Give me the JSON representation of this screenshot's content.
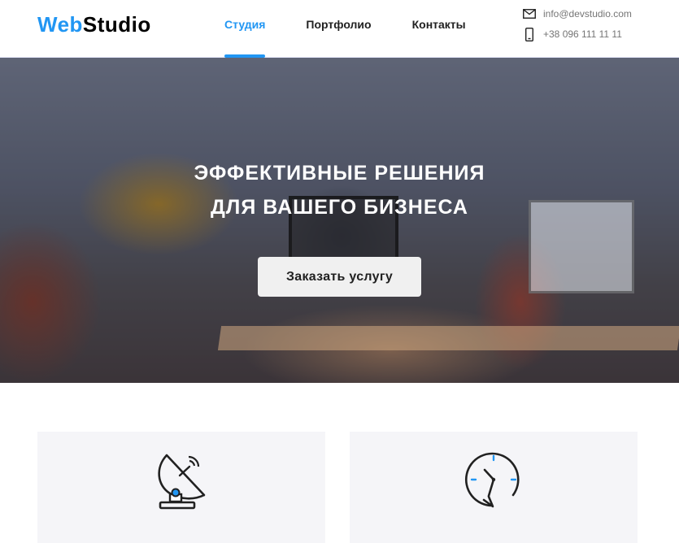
{
  "header": {
    "logo": {
      "part1": "Web",
      "part2": "Studio"
    },
    "nav": [
      {
        "label": "Студия",
        "active": true
      },
      {
        "label": "Портфолио",
        "active": false
      },
      {
        "label": "Контакты",
        "active": false
      }
    ],
    "contacts": {
      "email": {
        "icon": "envelope-icon",
        "text": "info@devstudio.com"
      },
      "phone": {
        "icon": "smartphone-icon",
        "text": "+38 096 111 11 11"
      }
    }
  },
  "hero": {
    "title_line1": "Эффективные решения",
    "title_line2": "для вашего бизнеса",
    "button_label": "Заказать услугу"
  },
  "features": [
    {
      "icon": "satellite-dish-icon"
    },
    {
      "icon": "clock-refresh-icon"
    }
  ],
  "colors": {
    "accent": "#2196f3",
    "text": "#212121",
    "muted": "#757575",
    "card_bg": "#f5f5f8",
    "button_bg": "#f0f0f0"
  }
}
